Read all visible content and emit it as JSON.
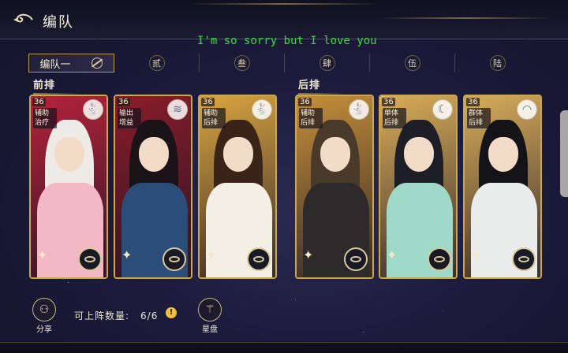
{
  "header": {
    "title": "编队"
  },
  "subtitle": "I'm so sorry but I love you",
  "tabs": [
    {
      "label": "编队一",
      "active": true
    },
    {
      "label": "贰"
    },
    {
      "label": "叁"
    },
    {
      "label": "肆"
    },
    {
      "label": "伍"
    },
    {
      "label": "陆"
    }
  ],
  "rows": {
    "front": "前排",
    "back": "后排"
  },
  "cards": [
    {
      "level": "36",
      "tags": [
        "辅助",
        "治疗"
      ],
      "badge_icon": "rabbit-icon",
      "colors": {
        "bg": "#b3233a",
        "hair": "#eeeae6",
        "robe": "#f2b8c4"
      }
    },
    {
      "level": "36",
      "tags": [
        "输出",
        "增益"
      ],
      "badge_icon": "fish-icon",
      "colors": {
        "bg": "#8a1c2a",
        "hair": "#1a1418",
        "robe": "#2b4d7a"
      }
    },
    {
      "level": "36",
      "tags": [
        "辅助",
        "后排"
      ],
      "badge_icon": "rabbit-icon",
      "colors": {
        "bg": "#d9a441",
        "hair": "#3a2418",
        "robe": "#f4efe4"
      }
    },
    {
      "level": "36",
      "tags": [
        "辅助",
        "后排"
      ],
      "badge_icon": "rabbit-icon",
      "colors": {
        "bg": "#c58f3a",
        "hair": "#4a3a2a",
        "robe": "#2c2a2a"
      }
    },
    {
      "level": "36",
      "tags": [
        "单体",
        "后排"
      ],
      "badge_icon": "moon-icon",
      "colors": {
        "bg": "#d9ad58",
        "hair": "#1e1e28",
        "robe": "#9fd9c8"
      }
    },
    {
      "level": "36",
      "tags": [
        "群体",
        "后排"
      ],
      "badge_icon": "wave-icon",
      "colors": {
        "bg": "#d7ac5a",
        "hair": "#141418",
        "robe": "#e9ecea"
      }
    }
  ],
  "bottom": {
    "share_label": "分享",
    "count_label": "可上阵数量:",
    "count_value": "6/6",
    "info_glyph": "!",
    "star_label": "星盘"
  }
}
